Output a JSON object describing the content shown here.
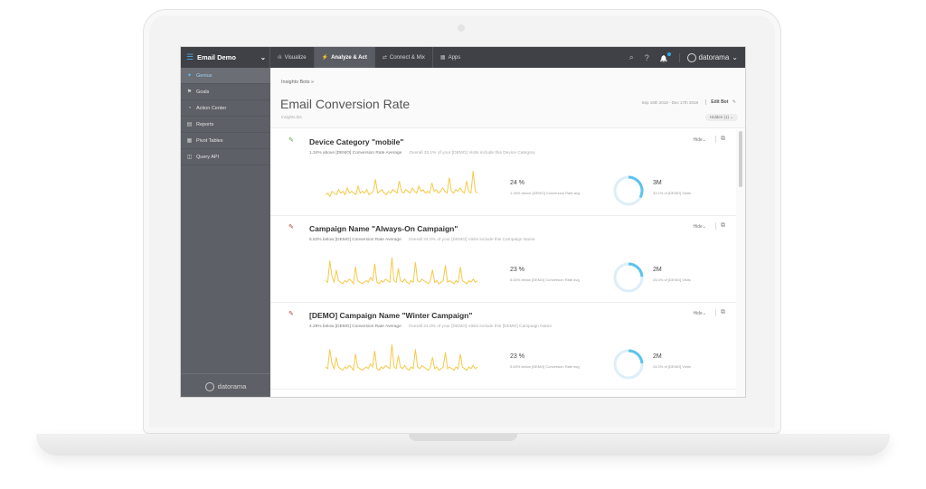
{
  "topbar": {
    "app_title": "Email Demo",
    "app_chevron": "⌄",
    "menu_icon": "menu-icon",
    "tabs": [
      {
        "label": "Visualize",
        "icon": "bar-chart-icon",
        "glyph": "ılı",
        "active": false
      },
      {
        "label": "Analyze & Act",
        "icon": "lightning-icon",
        "glyph": "⚡",
        "active": true
      },
      {
        "label": "Connect & Mix",
        "icon": "plug-icon",
        "glyph": "⇄",
        "active": false
      },
      {
        "label": "Apps",
        "icon": "grid-icon",
        "glyph": "▦",
        "active": false
      }
    ],
    "search_glyph": "⌕",
    "help_glyph": "?",
    "bell_glyph": "🔔",
    "brand": "datorama",
    "brand_chevron": "⌄"
  },
  "sidebar": {
    "items": [
      {
        "label": "Genius",
        "glyph": "✦",
        "icon": "bulb-icon",
        "active": true
      },
      {
        "label": "Goals",
        "glyph": "⚑",
        "icon": "flag-icon",
        "active": false
      },
      {
        "label": "Action Center",
        "glyph": "◔",
        "icon": "action-icon",
        "active": false
      },
      {
        "label": "Reports",
        "glyph": "▤",
        "icon": "report-icon",
        "active": false
      },
      {
        "label": "Pivot Tables",
        "glyph": "▦",
        "icon": "pivot-icon",
        "active": false
      },
      {
        "label": "Query API",
        "glyph": "◫",
        "icon": "api-icon",
        "active": false
      }
    ],
    "footer_brand": "datorama"
  },
  "header": {
    "breadcrumb": "Insights Bots »",
    "title": "Email Conversion Rate",
    "subtitle": "Insights.bts",
    "date_range": "Sep 19th 2018 - Dec 17th 2018",
    "edit_label": "Edit Bot",
    "edit_glyph": "✎",
    "hidden_label": "Hidden (1) ⌄"
  },
  "cards": [
    {
      "trend": "up",
      "trend_glyph": "✎",
      "title": "Device Category \"mobile\"",
      "subtitle": "1.34% above [DEMO] Conversion Rate Average",
      "subtitle_secondary": "Overall 33.1% of your [DEMO] Visits include this Device Category",
      "hide_label": "Hide⌄",
      "copy_glyph": "⧉",
      "metric_value": "24 %",
      "metric_desc": "1.34% above [DEMO] Conversion Rate avg",
      "donut_value": "3M",
      "donut_desc": "33.1% of [DEMO] Visits",
      "donut_fraction": 0.331,
      "spark": [
        4,
        5,
        3,
        6,
        5,
        4,
        7,
        5,
        6,
        4,
        8,
        5,
        6,
        5,
        4,
        9,
        5,
        6,
        5,
        7,
        4,
        5,
        6,
        13,
        5,
        6,
        7,
        5,
        4,
        6,
        5,
        7,
        6,
        5,
        12,
        6,
        5,
        7,
        6,
        5,
        8,
        6,
        5,
        9,
        6,
        7,
        5,
        6,
        5,
        11,
        6,
        7,
        5,
        6,
        8,
        6,
        5,
        14,
        6,
        5,
        7,
        6,
        8,
        6,
        5,
        12,
        6,
        5,
        18,
        6,
        5
      ]
    },
    {
      "trend": "down",
      "trend_glyph": "✎",
      "title": "Campaign Name \"Always-On Campaign\"",
      "subtitle": "5.63% below [DEMO] Conversion Rate Average",
      "subtitle_secondary": "Overall 24.0% of your [DEMO] Visits include this Campaign Name",
      "hide_label": "Hide⌄",
      "copy_glyph": "⧉",
      "metric_value": "23 %",
      "metric_desc": "5.63% below [DEMO] Conversion Rate avg",
      "donut_value": "2M",
      "donut_desc": "24.0% of [DEMO] Visits",
      "donut_fraction": 0.24,
      "spark": [
        5,
        4,
        18,
        8,
        4,
        12,
        5,
        4,
        3,
        5,
        4,
        6,
        5,
        3,
        14,
        5,
        4,
        3,
        4,
        5,
        4,
        7,
        5,
        16,
        4,
        3,
        5,
        4,
        6,
        5,
        4,
        20,
        5,
        4,
        13,
        5,
        4,
        6,
        4,
        3,
        5,
        4,
        17,
        5,
        4,
        6,
        5,
        4,
        3,
        5,
        12,
        4,
        5,
        3,
        4,
        5,
        15,
        4,
        5,
        4,
        3,
        5,
        4,
        14,
        5,
        4,
        3,
        5,
        4,
        6,
        4,
        5
      ]
    },
    {
      "trend": "down",
      "trend_glyph": "✎",
      "title": "[DEMO] Campaign Name \"Winter Campaign\"",
      "subtitle": "4.29% below [DEMO] Conversion Rate Average",
      "subtitle_secondary": "Overall 24.0% of your [DEMO] Visits include this [DEMO] Campaign Name",
      "hide_label": "Hide⌄",
      "copy_glyph": "⧉",
      "metric_value": "23 %",
      "metric_desc": "5.63% below [DEMO] Conversion Rate avg",
      "donut_value": "2M",
      "donut_desc": "24.0% of [DEMO] Visits",
      "donut_fraction": 0.24,
      "spark": [
        5,
        4,
        16,
        7,
        4,
        11,
        5,
        4,
        3,
        5,
        4,
        6,
        5,
        3,
        13,
        5,
        4,
        3,
        4,
        5,
        4,
        7,
        5,
        15,
        4,
        3,
        5,
        4,
        6,
        5,
        4,
        19,
        5,
        4,
        12,
        5,
        4,
        6,
        4,
        3,
        5,
        4,
        16,
        5,
        4,
        6,
        5,
        4,
        3,
        5,
        11,
        4,
        5,
        3,
        4,
        5,
        14,
        4,
        5,
        4,
        3,
        5,
        4,
        13,
        5,
        4,
        3,
        5,
        4,
        6,
        4,
        5
      ]
    }
  ],
  "colors": {
    "spark": "#f7c948",
    "donut_fill": "#5bc3ef",
    "donut_track": "#dceef9"
  }
}
